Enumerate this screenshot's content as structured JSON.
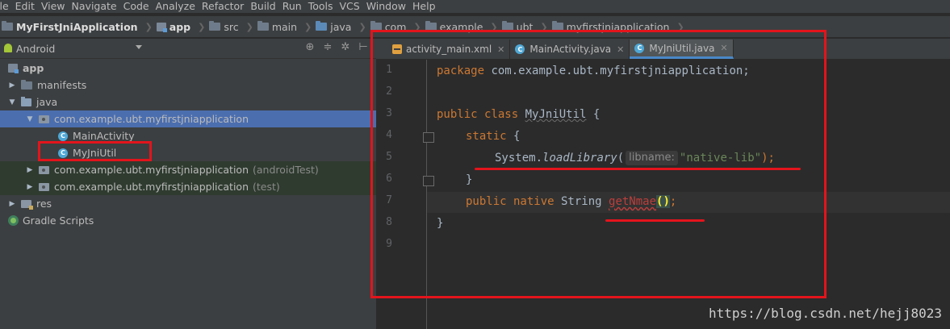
{
  "menu": [
    "ile",
    "Edit",
    "View",
    "Navigate",
    "Code",
    "Analyze",
    "Refactor",
    "Build",
    "Run",
    "Tools",
    "VCS",
    "Window",
    "Help"
  ],
  "breadcrumb": [
    "MyFirstJniApplication",
    "app",
    "src",
    "main",
    "java",
    "com",
    "example",
    "ubt",
    "myfirstjniapplication"
  ],
  "project": {
    "view_label": "Android",
    "toolbar_icons": [
      "target-icon",
      "collapse-icon",
      "gear-icon",
      "hide-icon"
    ],
    "tree": [
      {
        "label": "app",
        "icon": "module-icon",
        "bold": true
      },
      {
        "label": "manifests",
        "icon": "folder-icon"
      },
      {
        "label": "java",
        "icon": "java-folder-icon"
      },
      {
        "label": "com.example.ubt.myfirstjniapplication",
        "icon": "package-icon"
      },
      {
        "label": "MainActivity",
        "icon": "class-icon"
      },
      {
        "label": "MyJniUtil",
        "icon": "class-icon"
      },
      {
        "label": "com.example.ubt.myfirstjniapplication",
        "suffix": "(androidTest)",
        "icon": "package-icon"
      },
      {
        "label": "com.example.ubt.myfirstjniapplication",
        "suffix": "(test)",
        "icon": "package-icon"
      },
      {
        "label": "res",
        "icon": "res-folder-icon"
      },
      {
        "label": "Gradle Scripts",
        "icon": "gradle-icon"
      }
    ]
  },
  "tabs": [
    {
      "label": "activity_main.xml",
      "icon": "xml-icon"
    },
    {
      "label": "MainActivity.java",
      "icon": "class-icon"
    },
    {
      "label": "MyJniUtil.java",
      "icon": "class-icon",
      "active": true
    }
  ],
  "code": {
    "line_numbers": [
      "1",
      "2",
      "3",
      "4",
      "5",
      "6",
      "7",
      "8",
      "9"
    ],
    "l1_kw": "package",
    "l1_rest": " com.example.ubt.myfirstjniapplication;",
    "l3_kw": "public class",
    "l3_name": "MyJniUtil",
    "l3_rest": " {",
    "l4_kw": "static",
    "l4_rest": " {",
    "l5_a": "System.",
    "l5_method": "loadLibrary",
    "l5_open": "(",
    "l5_hint": "libname:",
    "l5_str": "\"native-lib\"",
    "l5_close": ");",
    "l6": "}",
    "l7_kw": "public native",
    "l7_type": " String ",
    "l7_name": "getNmae",
    "l7_paren": "()",
    "l7_semi": ";",
    "l8": "}"
  },
  "watermark": "https://blog.csdn.net/hejj8023",
  "colors": {
    "annotation": "#e3141c",
    "selection": "#4b6eaf",
    "keyword": "#cc7832",
    "string": "#6a8759"
  }
}
